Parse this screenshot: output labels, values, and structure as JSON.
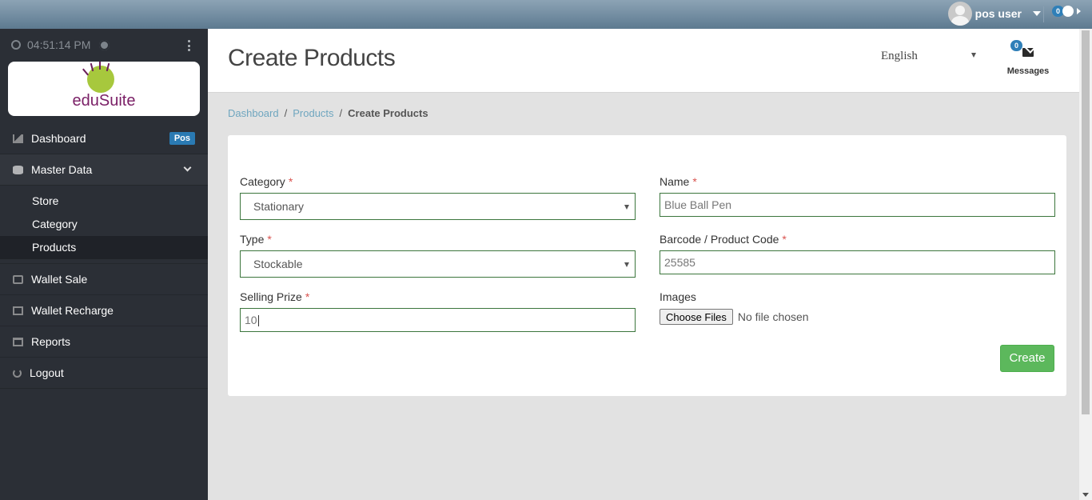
{
  "topbar": {
    "user_name": "pos user",
    "notification_count": "0"
  },
  "sidebar": {
    "time": "04:51:14 PM",
    "logo_text": "eduSuite",
    "items": [
      {
        "label": "Dashboard",
        "badge": "Pos",
        "icon": "chart-icon"
      },
      {
        "label": "Master Data",
        "icon": "database-icon"
      },
      {
        "label": "Wallet Sale",
        "icon": "cash-icon"
      },
      {
        "label": "Wallet Recharge",
        "icon": "checkbox-icon"
      },
      {
        "label": "Reports",
        "icon": "folder-icon"
      },
      {
        "label": "Logout",
        "icon": "power-icon"
      }
    ],
    "sub_items": [
      {
        "label": "Store"
      },
      {
        "label": "Category"
      },
      {
        "label": "Products",
        "active": true
      }
    ]
  },
  "header": {
    "title": "Create Products",
    "language": "English",
    "messages_count": "0",
    "messages_label": "Messages"
  },
  "breadcrumb": {
    "items": [
      "Dashboard",
      "Products"
    ],
    "current": "Create Products"
  },
  "form": {
    "category": {
      "label": "Category",
      "value": "Stationary"
    },
    "name": {
      "label": "Name",
      "value": "Blue Ball Pen"
    },
    "type": {
      "label": "Type",
      "value": "Stockable"
    },
    "barcode": {
      "label": "Barcode / Product Code",
      "value": "25585"
    },
    "selling_prize": {
      "label": "Selling Prize",
      "value": "10"
    },
    "images": {
      "label": "Images",
      "button": "Choose Files",
      "status": "No file chosen"
    },
    "required_mark": "*",
    "submit_label": "Create"
  },
  "colors": {
    "accent": "#5cb85c",
    "sidebar_bg": "#2b2f36",
    "badge": "#2a7ab3",
    "link": "#6fa6bf",
    "input_border": "#3c763d"
  }
}
